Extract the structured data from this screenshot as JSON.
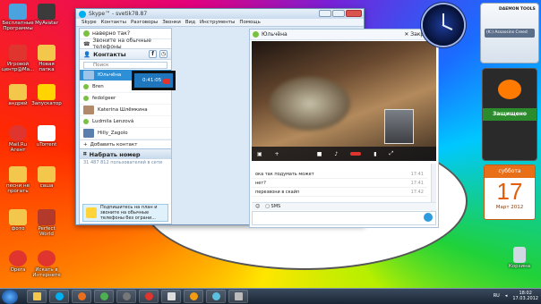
{
  "desktop_icons": [
    {
      "label": "Бесплатные Программы",
      "color": "#4aa3df"
    },
    {
      "label": "MyAvatar",
      "color": "#3b3b3b"
    },
    {
      "label": "Игровой центр@Ma...",
      "color": "#e0342e"
    },
    {
      "label": "Новая папка",
      "color": "#f3c74c"
    },
    {
      "label": "андрей",
      "color": "#f3c74c"
    },
    {
      "label": "Запускатор",
      "color": "#ffd400"
    },
    {
      "label": "Mail.Ru Агент",
      "color": "#e0342e"
    },
    {
      "label": "uTorrent",
      "color": "#ffffff"
    },
    {
      "label": "песни не прогать",
      "color": "#f3c74c"
    },
    {
      "label": "саша",
      "color": "#f3c74c"
    },
    {
      "label": "фото",
      "color": "#f3c74c"
    },
    {
      "label": "Perfect World",
      "color": "#b33a2a"
    },
    {
      "label": "Opera",
      "color": "#e0342e"
    },
    {
      "label": "Искать в Интернете",
      "color": "#e0342e"
    }
  ],
  "skype": {
    "title": "Skype™ - svetik78.87",
    "menu": [
      "Skype",
      "Контакты",
      "Разговоры",
      "Звонки",
      "Вид",
      "Инструменты",
      "Помощь"
    ],
    "status_text": "наверно так?",
    "call_phones": "Звоните на обычные телефоны",
    "contacts_label": "Контакты",
    "search_placeholder": "Поиск",
    "active_call": {
      "name": "Юльчёна",
      "time": "0:41:05"
    },
    "contacts": [
      "Bren",
      "fedolgeer",
      "Katerina Шлёмкина",
      "Ludmila Lenzová",
      "Hilly_Zagolo"
    ],
    "add_contact": "Добавить контакт",
    "dial_label": "Набрать номер",
    "online_count": "31 487 812 пользователей в сети",
    "promo_text": "Подпишитесь на план и звоните на обычные телефоны без ограни...",
    "chat": {
      "contact": "Юльчёна",
      "close_label": "Закрыть",
      "messages": [
        {
          "text": "ока так подумать может",
          "time": "17:41"
        },
        {
          "text": "нет?",
          "time": "17:41"
        },
        {
          "text": "перезвони в скайп",
          "time": "17:42"
        }
      ],
      "sms_label": "SMS"
    }
  },
  "calendar": {
    "weekday": "суббота",
    "day": "17",
    "month_year": "Март 2012"
  },
  "daemon": {
    "brand": "DAEMON TOOLS",
    "drive": "(K:) Assassins Creed"
  },
  "avast": {
    "status": "Защищено"
  },
  "recycle_bin": "Корзина",
  "tray": {
    "lang": "RU",
    "time": "18:02",
    "date": "17.03.2012"
  }
}
